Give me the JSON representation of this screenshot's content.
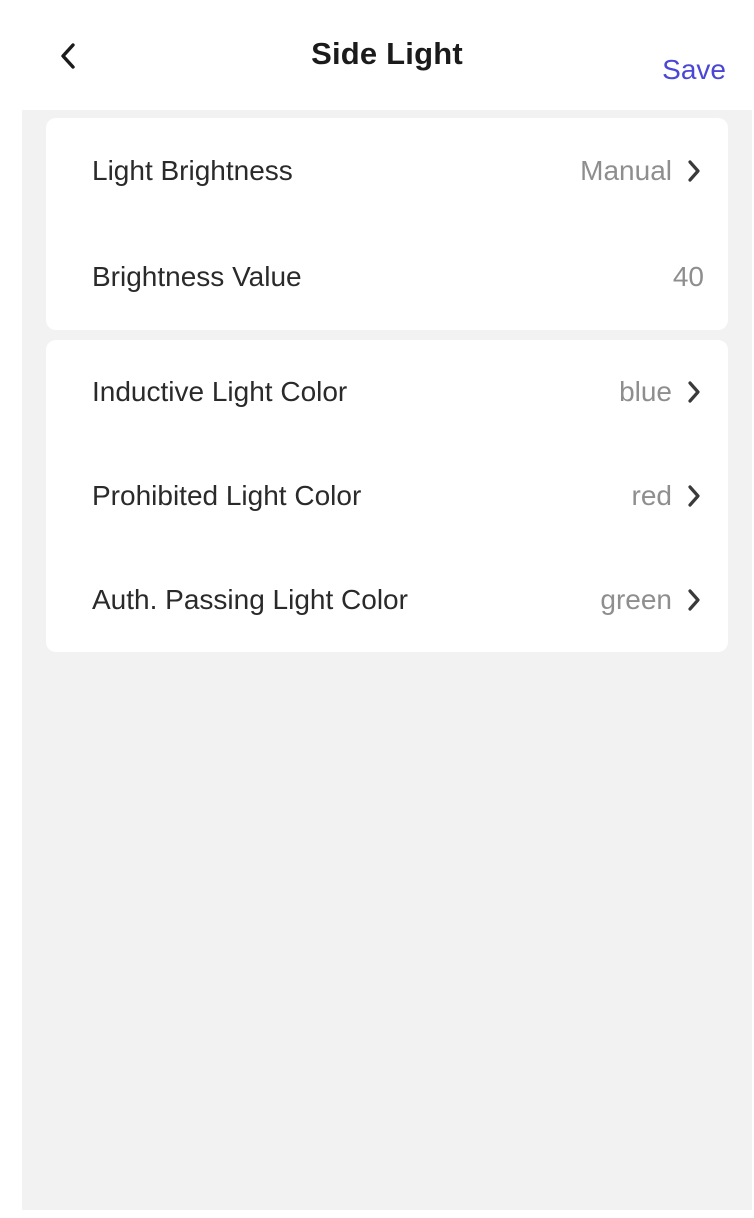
{
  "header": {
    "title": "Side Light",
    "save_label": "Save",
    "back_icon": "chevron-left-icon"
  },
  "brightness_group": {
    "rows": [
      {
        "label": "Light Brightness",
        "value": "Manual",
        "has_chevron": true
      },
      {
        "label": "Brightness Value",
        "value": "40",
        "has_chevron": false
      }
    ]
  },
  "color_group": {
    "rows": [
      {
        "label": "Inductive Light Color",
        "value": "blue",
        "has_chevron": true
      },
      {
        "label": "Prohibited Light Color",
        "value": "red",
        "has_chevron": true
      },
      {
        "label": "Auth. Passing Light Color",
        "value": "green",
        "has_chevron": true
      }
    ]
  },
  "colors": {
    "accent": "#4a47d6",
    "background": "#f2f2f2",
    "card": "#ffffff",
    "label_text": "#2a2a2a",
    "value_text": "#8e8e8e"
  }
}
